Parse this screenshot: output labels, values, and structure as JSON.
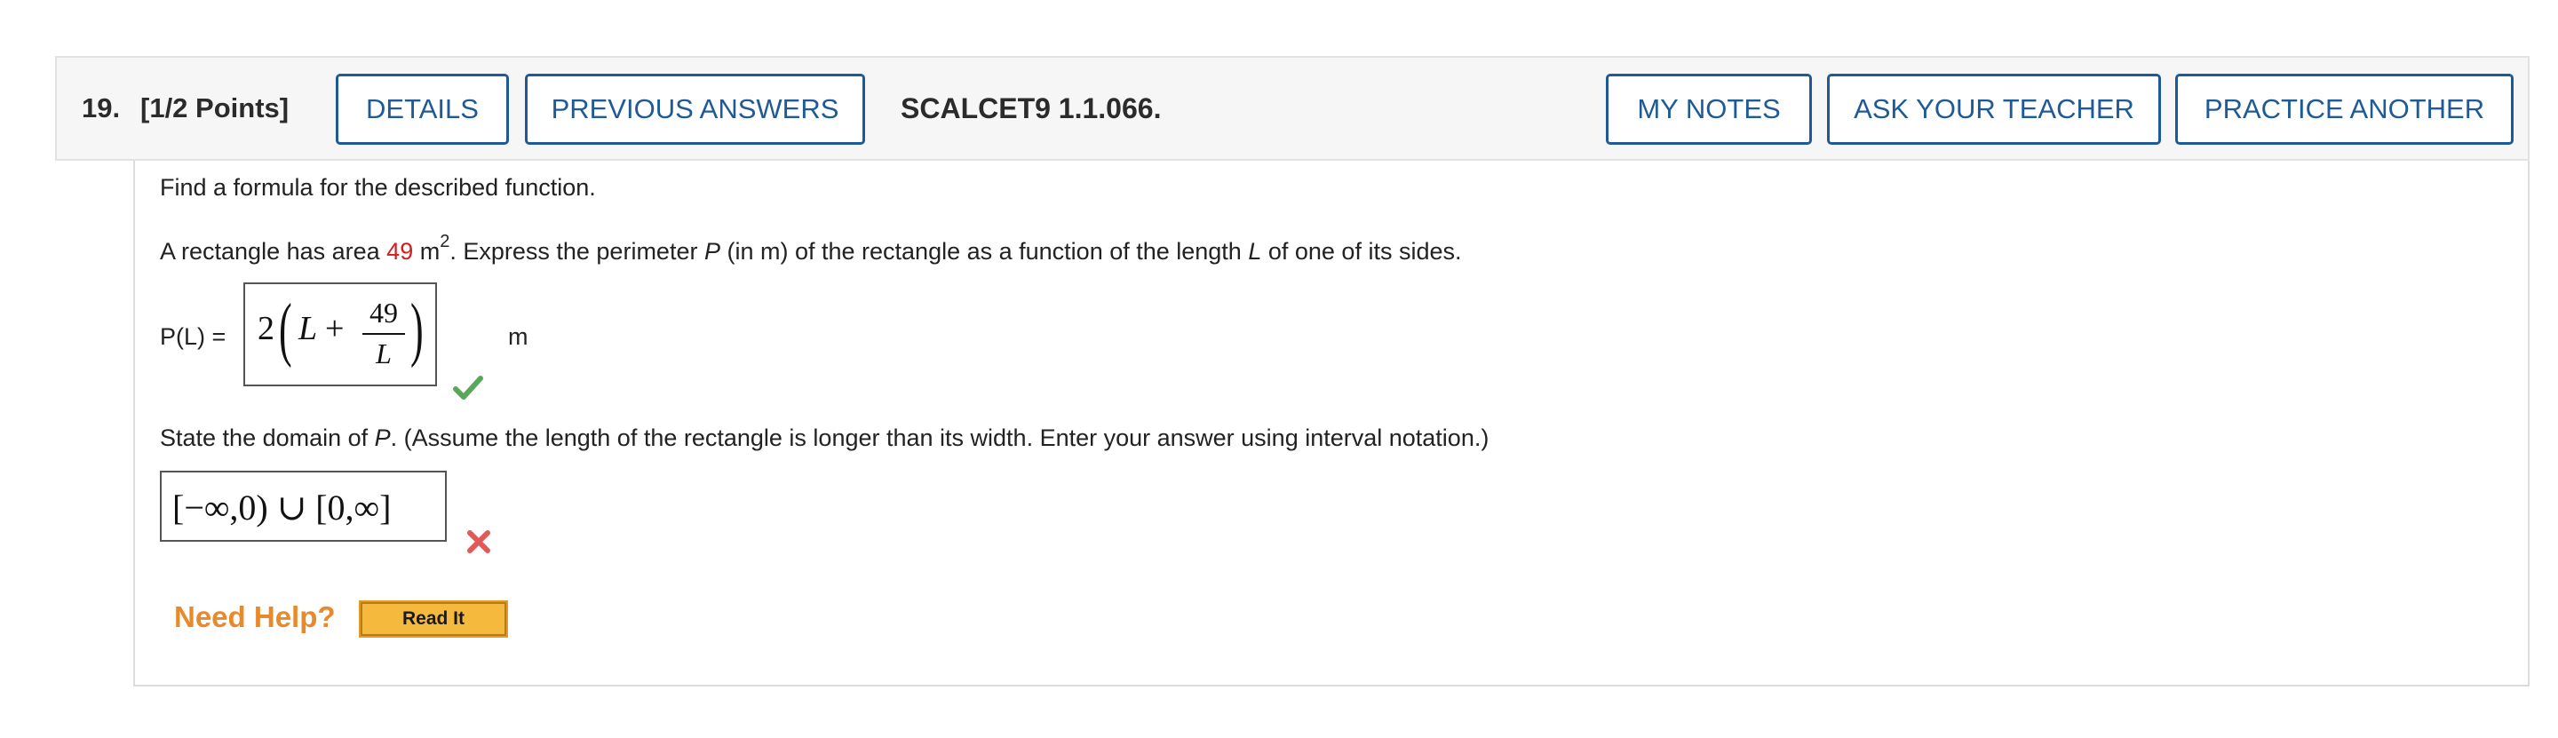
{
  "header": {
    "question_number": "19.",
    "points": "[1/2 Points]",
    "details_label": "DETAILS",
    "previous_answers_label": "PREVIOUS ANSWERS",
    "question_id": "SCALCET9 1.1.066.",
    "my_notes_label": "MY NOTES",
    "ask_teacher_label": "ASK YOUR TEACHER",
    "practice_another_label": "PRACTICE ANOTHER"
  },
  "problem": {
    "instruction": "Find a formula for the described function.",
    "statement_start": "A rectangle has area ",
    "area_value": "49",
    "area_unit": " m",
    "area_exp": "2",
    "statement_rest_1": ". Express the perimeter ",
    "perimeter_var": "P",
    "statement_rest_2": " (in m) of the rectangle as a function of the length ",
    "length_var": "L",
    "statement_rest_3": " of one of its sides.",
    "answer1_label": "P(L) =",
    "answer1": {
      "coefficient": "2",
      "variable": "L",
      "plus": "+",
      "numerator": "49",
      "denominator": "L"
    },
    "answer1_unit": "m",
    "answer1_status": "correct",
    "domain_prompt_1": "State the domain of ",
    "domain_var": "P",
    "domain_prompt_2": ". (Assume the length of the rectangle is longer than its width. Enter your answer using interval notation.)",
    "answer2": "[−∞,0) ∪ [0,∞]",
    "answer2_status": "incorrect"
  },
  "help": {
    "need_help_label": "Need Help?",
    "read_it_label": "Read It"
  },
  "colors": {
    "button_blue": "#1f5a96",
    "accent_red": "#d21e1e",
    "check_green": "#5aa65a",
    "cross_red": "#e05a5a",
    "help_orange": "#e88a2c"
  }
}
